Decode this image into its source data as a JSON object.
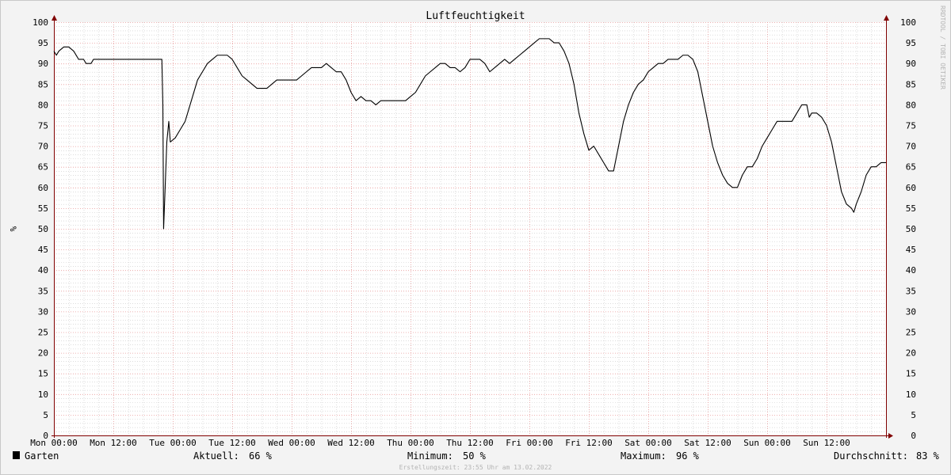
{
  "chart_data": {
    "type": "line",
    "title": "Luftfeuchtigkeit",
    "ylabel": "%",
    "ylabel_right": "%",
    "watermark": "RRDTOOL / TOBI OETIKER",
    "ylim": [
      0,
      100
    ],
    "y_ticks": [
      0,
      5,
      10,
      15,
      20,
      25,
      30,
      35,
      40,
      45,
      50,
      55,
      60,
      65,
      70,
      75,
      80,
      85,
      90,
      95,
      100
    ],
    "x_range_hours": [
      0,
      168
    ],
    "x_ticks": [
      {
        "h": 0,
        "label": "Mon 00:00"
      },
      {
        "h": 12,
        "label": "Mon 12:00"
      },
      {
        "h": 24,
        "label": "Tue 00:00"
      },
      {
        "h": 36,
        "label": "Tue 12:00"
      },
      {
        "h": 48,
        "label": "Wed 00:00"
      },
      {
        "h": 60,
        "label": "Wed 12:00"
      },
      {
        "h": 72,
        "label": "Thu 00:00"
      },
      {
        "h": 84,
        "label": "Thu 12:00"
      },
      {
        "h": 96,
        "label": "Fri 00:00"
      },
      {
        "h": 108,
        "label": "Fri 12:00"
      },
      {
        "h": 120,
        "label": "Sat 00:00"
      },
      {
        "h": 132,
        "label": "Sat 12:00"
      },
      {
        "h": 144,
        "label": "Sun 00:00"
      },
      {
        "h": 156,
        "label": "Sun 12:00"
      }
    ],
    "grid": true,
    "series": [
      {
        "name": "Garten",
        "color": "#000000",
        "points": [
          [
            0,
            93
          ],
          [
            0.5,
            92
          ],
          [
            1,
            93
          ],
          [
            2,
            94
          ],
          [
            3,
            94
          ],
          [
            4,
            93
          ],
          [
            5,
            91
          ],
          [
            6,
            91
          ],
          [
            6.5,
            90
          ],
          [
            7.5,
            90
          ],
          [
            8,
            91
          ],
          [
            9,
            91
          ],
          [
            12,
            91
          ],
          [
            16,
            91
          ],
          [
            21.8,
            91
          ],
          [
            22.0,
            80
          ],
          [
            22.15,
            50
          ],
          [
            22.4,
            58
          ],
          [
            22.8,
            71
          ],
          [
            23.2,
            76
          ],
          [
            23.5,
            71
          ],
          [
            24.5,
            72
          ],
          [
            25.5,
            74
          ],
          [
            26.5,
            76
          ],
          [
            27,
            78
          ],
          [
            28,
            82
          ],
          [
            29,
            86
          ],
          [
            30,
            88
          ],
          [
            31,
            90
          ],
          [
            32,
            91
          ],
          [
            33,
            92
          ],
          [
            34,
            92
          ],
          [
            35,
            92
          ],
          [
            36,
            91
          ],
          [
            37,
            89
          ],
          [
            38,
            87
          ],
          [
            39,
            86
          ],
          [
            40,
            85
          ],
          [
            41,
            84
          ],
          [
            42,
            84
          ],
          [
            43,
            84
          ],
          [
            44,
            85
          ],
          [
            45,
            86
          ],
          [
            48,
            86
          ],
          [
            49,
            86
          ],
          [
            50,
            87
          ],
          [
            51,
            88
          ],
          [
            52,
            89
          ],
          [
            54,
            89
          ],
          [
            55,
            90
          ],
          [
            56,
            89
          ],
          [
            57,
            88
          ],
          [
            58,
            88
          ],
          [
            59,
            86
          ],
          [
            60,
            83
          ],
          [
            61,
            81
          ],
          [
            62,
            82
          ],
          [
            63,
            81
          ],
          [
            64,
            81
          ],
          [
            65,
            80
          ],
          [
            66,
            81
          ],
          [
            68,
            81
          ],
          [
            70,
            81
          ],
          [
            71,
            81
          ],
          [
            72,
            82
          ],
          [
            73,
            83
          ],
          [
            74,
            85
          ],
          [
            75,
            87
          ],
          [
            76,
            88
          ],
          [
            77,
            89
          ],
          [
            78,
            90
          ],
          [
            79,
            90
          ],
          [
            80,
            89
          ],
          [
            81,
            89
          ],
          [
            82,
            88
          ],
          [
            83,
            89
          ],
          [
            84,
            91
          ],
          [
            85,
            91
          ],
          [
            86,
            91
          ],
          [
            87,
            90
          ],
          [
            88,
            88
          ],
          [
            89,
            89
          ],
          [
            90,
            90
          ],
          [
            91,
            91
          ],
          [
            92,
            90
          ],
          [
            93,
            91
          ],
          [
            94,
            92
          ],
          [
            95,
            93
          ],
          [
            96,
            94
          ],
          [
            97,
            95
          ],
          [
            98,
            96
          ],
          [
            99,
            96
          ],
          [
            100,
            96
          ],
          [
            101,
            95
          ],
          [
            102,
            95
          ],
          [
            103,
            93
          ],
          [
            104,
            90
          ],
          [
            105,
            85
          ],
          [
            106,
            78
          ],
          [
            107,
            73
          ],
          [
            108,
            69
          ],
          [
            109,
            70
          ],
          [
            110,
            68
          ],
          [
            111,
            66
          ],
          [
            112,
            64
          ],
          [
            113,
            64
          ],
          [
            114,
            70
          ],
          [
            115,
            76
          ],
          [
            116,
            80
          ],
          [
            117,
            83
          ],
          [
            118,
            85
          ],
          [
            119,
            86
          ],
          [
            120,
            88
          ],
          [
            121,
            89
          ],
          [
            122,
            90
          ],
          [
            123,
            90
          ],
          [
            124,
            91
          ],
          [
            125,
            91
          ],
          [
            126,
            91
          ],
          [
            127,
            92
          ],
          [
            128,
            92
          ],
          [
            129,
            91
          ],
          [
            130,
            88
          ],
          [
            131,
            82
          ],
          [
            132,
            76
          ],
          [
            133,
            70
          ],
          [
            134,
            66
          ],
          [
            135,
            63
          ],
          [
            136,
            61
          ],
          [
            137,
            60
          ],
          [
            138,
            60
          ],
          [
            139,
            63
          ],
          [
            140,
            65
          ],
          [
            141,
            65
          ],
          [
            142,
            67
          ],
          [
            143,
            70
          ],
          [
            144,
            72
          ],
          [
            145,
            74
          ],
          [
            146,
            76
          ],
          [
            147,
            76
          ],
          [
            148,
            76
          ],
          [
            149,
            76
          ],
          [
            150,
            78
          ],
          [
            151,
            80
          ],
          [
            152,
            80
          ],
          [
            152.5,
            77
          ],
          [
            153,
            78
          ],
          [
            154,
            78
          ],
          [
            155,
            77
          ],
          [
            156,
            75
          ],
          [
            157,
            71
          ],
          [
            158,
            65
          ],
          [
            159,
            59
          ],
          [
            160,
            56
          ],
          [
            161,
            55
          ],
          [
            161.5,
            54
          ],
          [
            162,
            56
          ],
          [
            163,
            59
          ],
          [
            164,
            63
          ],
          [
            165,
            65
          ],
          [
            166,
            65
          ],
          [
            167,
            66
          ],
          [
            168,
            66
          ]
        ]
      }
    ]
  },
  "legend": {
    "series_name": "Garten",
    "series_color": "#000000",
    "aktuell_label": "Aktuell:",
    "aktuell_value": "66 %",
    "minimum_label": "Minimum:",
    "minimum_value": "50 %",
    "maximum_label": "Maximum:",
    "maximum_value": "96 %",
    "durchschnitt_label": "Durchschnitt:",
    "durchschnitt_value": "83 %"
  },
  "footer": {
    "creation_time": "Erstellungszeit: 23:55 Uhr am 13.02.2022"
  },
  "colors": {
    "background": "#f3f3f3",
    "plot_background": "#ffffff",
    "major_grid": "#e89a9a",
    "minor_grid": "#c8c8c8",
    "axis": "#800000"
  }
}
